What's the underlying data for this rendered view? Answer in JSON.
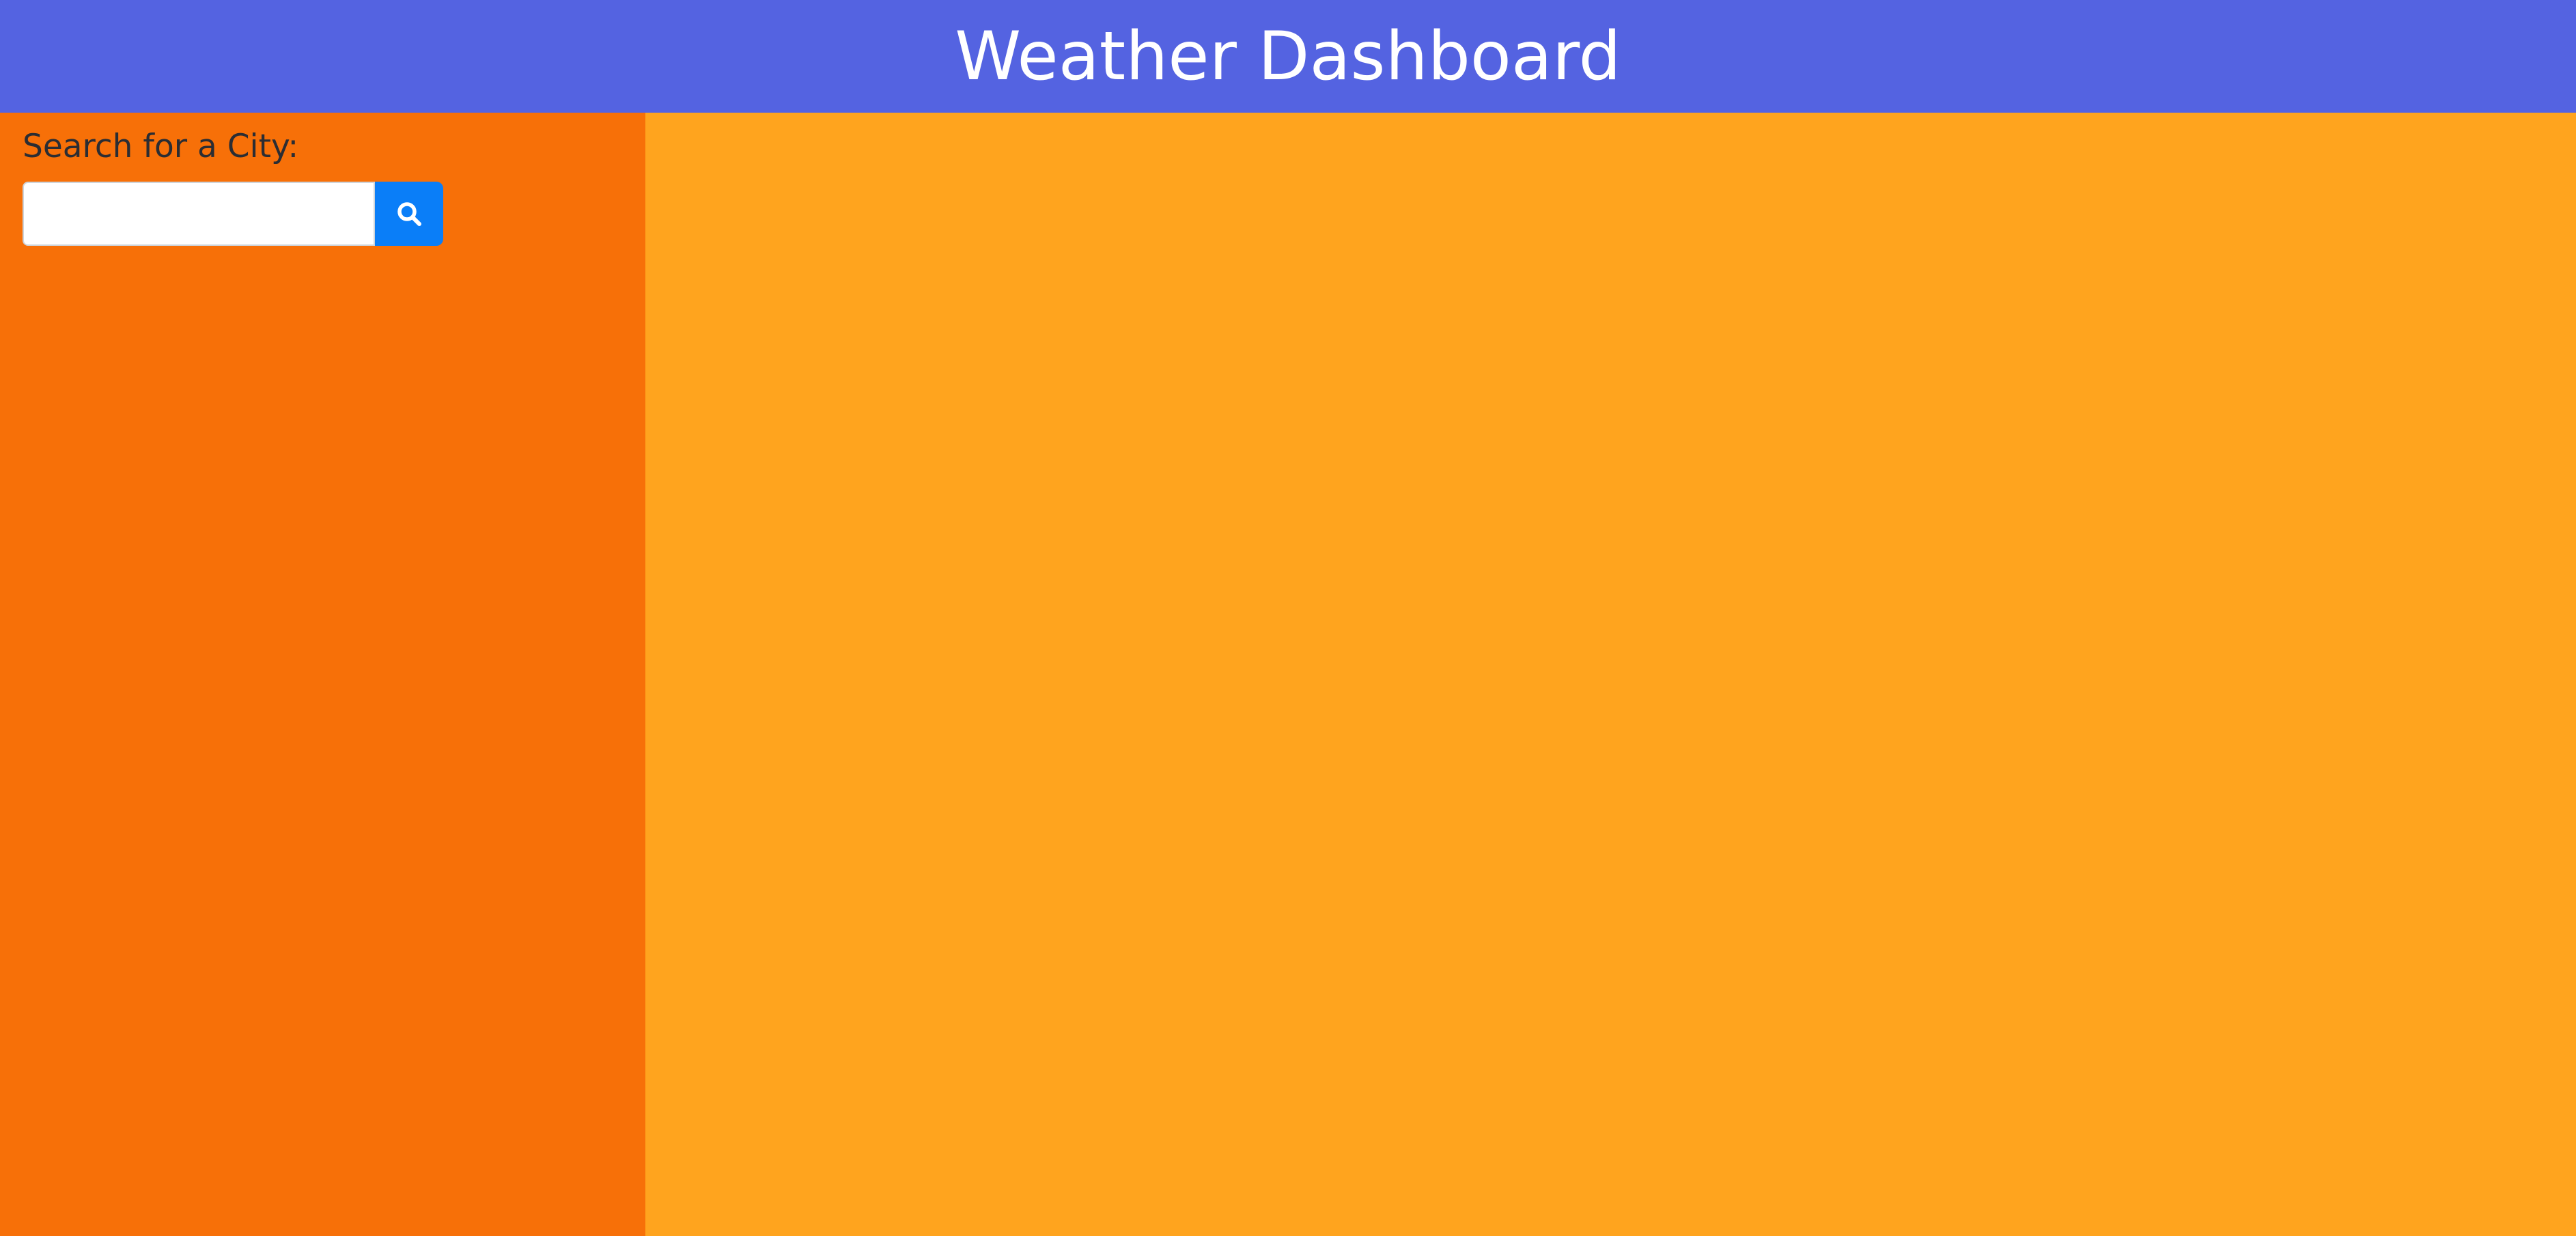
{
  "header": {
    "title": "Weather Dashboard",
    "bg_color": "#5463e1",
    "text_color": "#ffffff"
  },
  "sidebar": {
    "bg_color": "#f77008",
    "search_label": "Search for a City:",
    "label_color": "#2b2d33",
    "search_input": {
      "value": "",
      "placeholder": ""
    },
    "search_button": {
      "icon": "search-icon",
      "bg_color": "#0a7ef8",
      "icon_color": "#ffffff"
    }
  },
  "main": {
    "bg_color": "#ffa41e"
  }
}
